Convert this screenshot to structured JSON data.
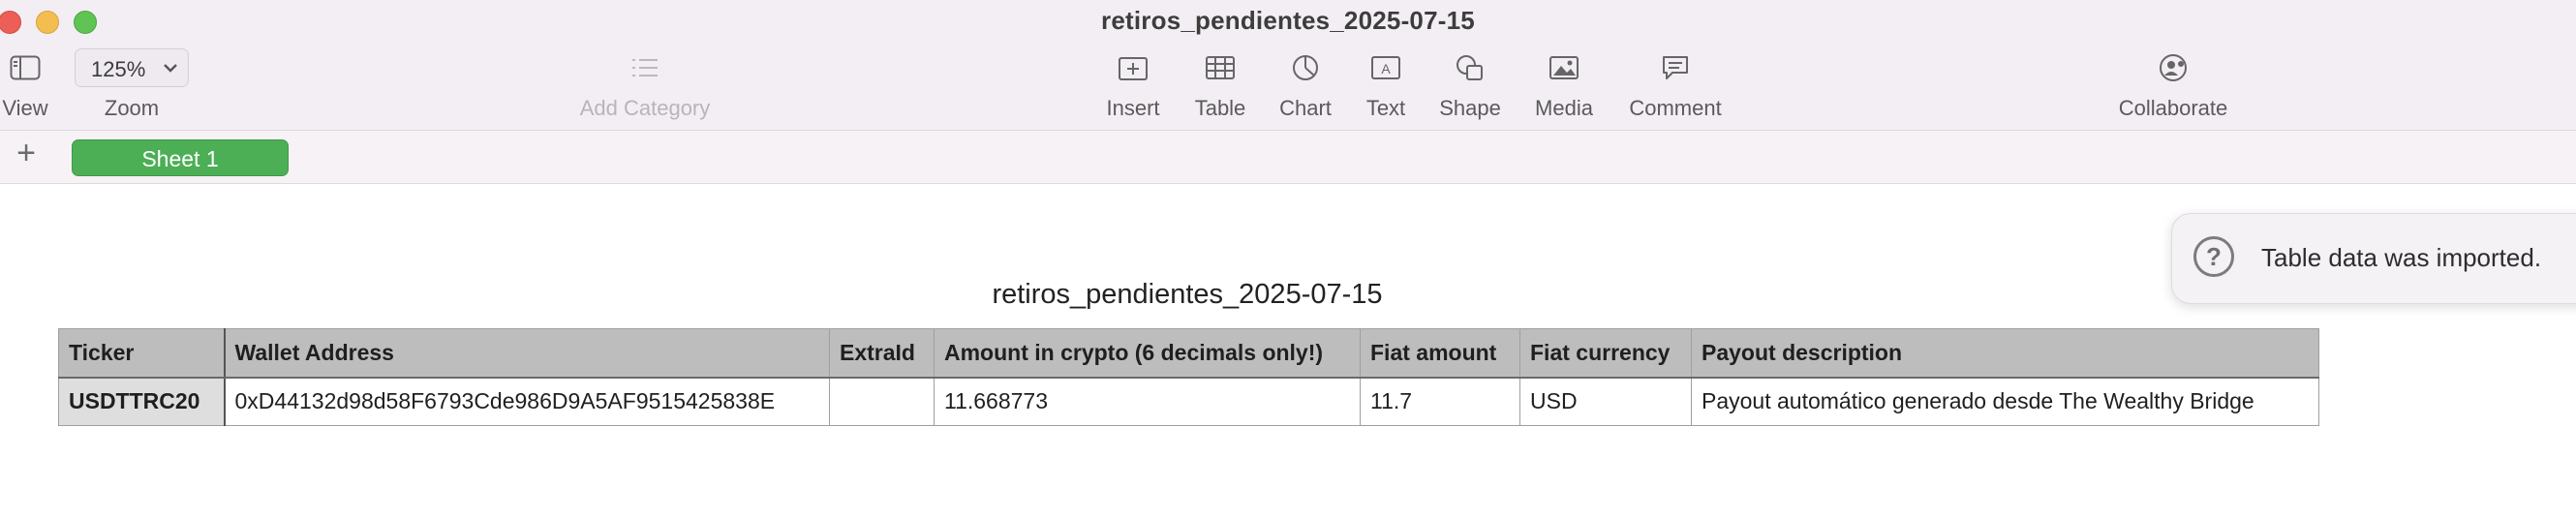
{
  "window": {
    "title": "retiros_pendientes_2025-07-15"
  },
  "toolbar": {
    "view_label": "View",
    "zoom_value": "125%",
    "zoom_label": "Zoom",
    "add_category_label": "Add Category",
    "insert_label": "Insert",
    "table_label": "Table",
    "chart_label": "Chart",
    "text_label": "Text",
    "shape_label": "Shape",
    "media_label": "Media",
    "comment_label": "Comment",
    "collaborate_label": "Collaborate"
  },
  "sheets": {
    "add_symbol": "+",
    "tabs": [
      "Sheet 1"
    ]
  },
  "notification": {
    "message": "Table data was imported."
  },
  "table": {
    "title": "retiros_pendientes_2025-07-15",
    "headers": [
      "Ticker",
      "Wallet Address",
      "ExtraId",
      "Amount in crypto (6 decimals only!)",
      "Fiat amount",
      "Fiat currency",
      "Payout description"
    ],
    "rows": [
      [
        "USDTTRC20",
        "0xD44132d98d58F6793Cde986D9A5AF9515425838E",
        "",
        "11.668773",
        "11.7",
        "USD",
        "Payout automático generado desde The Wealthy Bridge"
      ]
    ]
  },
  "colors": {
    "sheet_tab": "#4caf55",
    "toolbar_bg": "#f3eef4",
    "header_row": "#bdbdbd"
  }
}
